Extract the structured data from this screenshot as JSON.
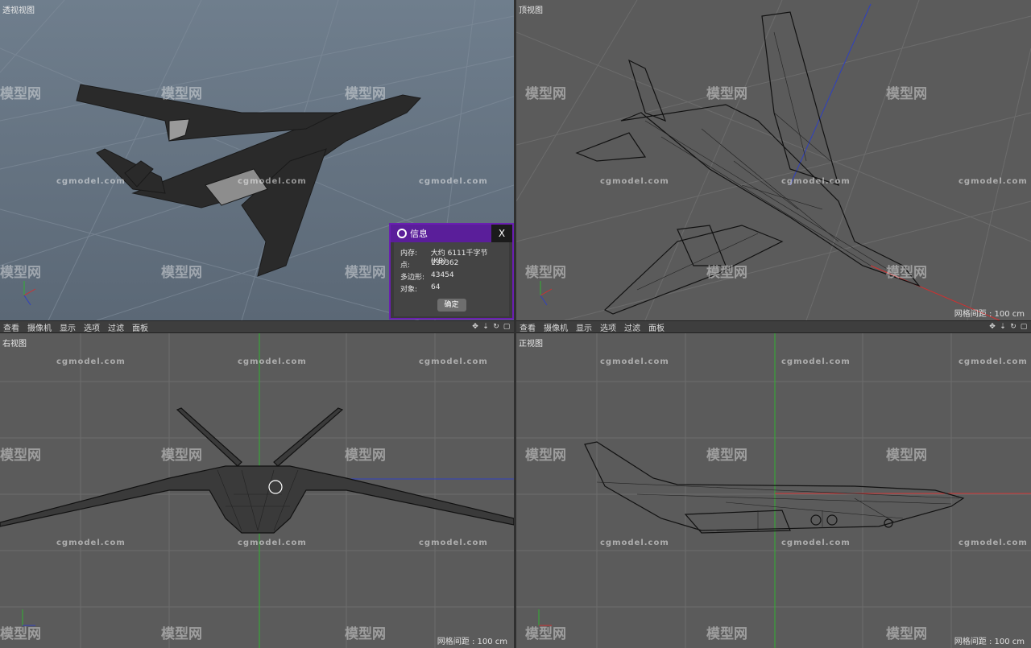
{
  "viewports": {
    "perspective": {
      "label": "透视视图"
    },
    "top": {
      "label": "顶视图",
      "grid": "网格间距 : 100 cm"
    },
    "right": {
      "label": "右视图",
      "grid": "网格间距 : 100 cm"
    },
    "front": {
      "label": "正视图",
      "grid": "网格间距 : 100 cm"
    }
  },
  "menubar": {
    "items": [
      "查看",
      "摄像机",
      "显示",
      "选项",
      "过滤",
      "面板"
    ]
  },
  "watermark": {
    "text": "cgmodel.com",
    "logo": "模型网"
  },
  "dialog": {
    "title": "信息",
    "close": "X",
    "rows": [
      {
        "key": "内存:",
        "value": "大约 6111千字节(KB)"
      },
      {
        "key": "点:",
        "value": "130362"
      },
      {
        "key": "多边形:",
        "value": "43454"
      },
      {
        "key": "对象:",
        "value": "64"
      }
    ],
    "ok": "确定"
  },
  "colors": {
    "accent": "#6a1fb1",
    "axis_x": "#d03030",
    "axis_y": "#30b030",
    "axis_z": "#3040c0"
  }
}
